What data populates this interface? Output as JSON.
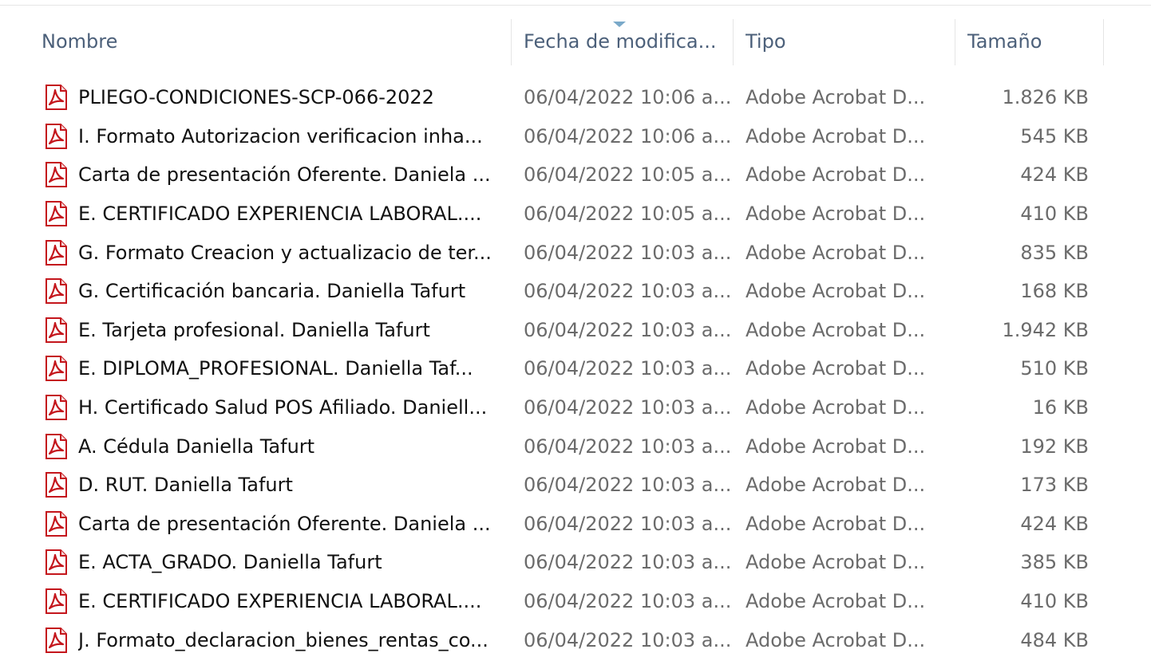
{
  "columns": {
    "name": "Nombre",
    "date": "Fecha de modifica...",
    "type": "Tipo",
    "size": "Tamaño"
  },
  "files": [
    {
      "name": "PLIEGO-CONDICIONES-SCP-066-2022",
      "date": "06/04/2022 10:06 a...",
      "type": "Adobe Acrobat D...",
      "size": "1.826 KB",
      "icon": "pdf-icon"
    },
    {
      "name": "I. Formato Autorizacion verificacion inha...",
      "date": "06/04/2022 10:06 a...",
      "type": "Adobe Acrobat D...",
      "size": "545 KB",
      "icon": "pdf-icon"
    },
    {
      "name": "Carta de presentación Oferente. Daniela ...",
      "date": "06/04/2022 10:05 a...",
      "type": "Adobe Acrobat D...",
      "size": "424 KB",
      "icon": "pdf-icon"
    },
    {
      "name": "E. CERTIFICADO EXPERIENCIA LABORAL....",
      "date": "06/04/2022 10:05 a...",
      "type": "Adobe Acrobat D...",
      "size": "410 KB",
      "icon": "pdf-icon"
    },
    {
      "name": "G. Formato Creacion y actualizacio de ter...",
      "date": "06/04/2022 10:03 a...",
      "type": "Adobe Acrobat D...",
      "size": "835 KB",
      "icon": "pdf-icon"
    },
    {
      "name": "G. Certificación bancaria. Daniella Tafurt",
      "date": "06/04/2022 10:03 a...",
      "type": "Adobe Acrobat D...",
      "size": "168 KB",
      "icon": "pdf-icon"
    },
    {
      "name": "E. Tarjeta profesional. Daniella Tafurt",
      "date": "06/04/2022 10:03 a...",
      "type": "Adobe Acrobat D...",
      "size": "1.942 KB",
      "icon": "pdf-icon"
    },
    {
      "name": "E. DIPLOMA_PROFESIONAL. Daniella Taf...",
      "date": "06/04/2022 10:03 a...",
      "type": "Adobe Acrobat D...",
      "size": "510 KB",
      "icon": "pdf-icon"
    },
    {
      "name": "H. Certificado Salud POS Afiliado. Daniell...",
      "date": "06/04/2022 10:03 a...",
      "type": "Adobe Acrobat D...",
      "size": "16 KB",
      "icon": "pdf-icon"
    },
    {
      "name": "A. Cédula Daniella Tafurt",
      "date": "06/04/2022 10:03 a...",
      "type": "Adobe Acrobat D...",
      "size": "192 KB",
      "icon": "pdf-icon"
    },
    {
      "name": "D. RUT. Daniella Tafurt",
      "date": "06/04/2022 10:03 a...",
      "type": "Adobe Acrobat D...",
      "size": "173 KB",
      "icon": "pdf-icon"
    },
    {
      "name": "Carta de presentación Oferente. Daniela ...",
      "date": "06/04/2022 10:03 a...",
      "type": "Adobe Acrobat D...",
      "size": "424 KB",
      "icon": "pdf-icon"
    },
    {
      "name": "E. ACTA_GRADO. Daniella Tafurt",
      "date": "06/04/2022 10:03 a...",
      "type": "Adobe Acrobat D...",
      "size": "385 KB",
      "icon": "pdf-icon"
    },
    {
      "name": "E. CERTIFICADO EXPERIENCIA LABORAL....",
      "date": "06/04/2022 10:03 a...",
      "type": "Adobe Acrobat D...",
      "size": "410 KB",
      "icon": "pdf-icon"
    },
    {
      "name": "J. Formato_declaracion_bienes_rentas_co...",
      "date": "06/04/2022 10:03 a...",
      "type": "Adobe Acrobat D...",
      "size": "484 KB",
      "icon": "pdf-icon"
    }
  ],
  "colors": {
    "header_text": "#4c607a",
    "secondary_text": "#6b6b6b",
    "pdf_red": "#c4161c",
    "sort_arrow": "#7aa9c9"
  }
}
